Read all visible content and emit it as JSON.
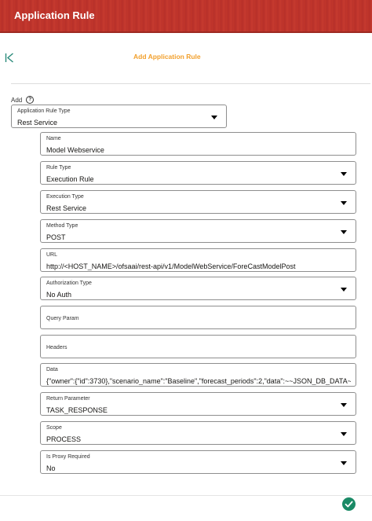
{
  "header": {
    "title": "Application Rule"
  },
  "toolbar": {
    "back_icon": "first-page-icon",
    "subtitle": "Add Application Rule"
  },
  "form": {
    "add_label": "Add",
    "help_icon": "?",
    "app_rule_type": {
      "label": "Application Rule Type",
      "value": "Rest Service"
    },
    "name": {
      "label": "Name",
      "value": "Model Webservice"
    },
    "rule_type": {
      "label": "Rule Type",
      "value": "Execution Rule"
    },
    "execution_type": {
      "label": "Execution Type",
      "value": "Rest Service"
    },
    "method_type": {
      "label": "Method Type",
      "value": "POST"
    },
    "url": {
      "label": "URL",
      "value": "http://<HOST_NAME>/ofsaai/rest-api/v1/ModelWebService/ForeCastModelPost"
    },
    "authorization_type": {
      "label": "Authorization Type",
      "value": "No Auth"
    },
    "query_param": {
      "label": "Query Param",
      "value": ""
    },
    "headers": {
      "label": "Headers",
      "value": ""
    },
    "data": {
      "label": "Data",
      "value": "{\"owner\":{\"id\":3730},\"scenario_name\":\"Baseline\",\"forecast_periods\":2,\"data\":~~JSON_DB_DATA~"
    },
    "return_parameter": {
      "label": "Return Parameter",
      "value": "TASK_RESPONSE"
    },
    "scope": {
      "label": "Scope",
      "value": "PROCESS"
    },
    "is_proxy_required": {
      "label": "Is Proxy Required",
      "value": "No"
    }
  },
  "footer": {
    "save_icon": "check-circle-icon"
  },
  "colors": {
    "header": "#c2362b",
    "subtitle": "#f2a02d",
    "save": "#1a8a66"
  }
}
